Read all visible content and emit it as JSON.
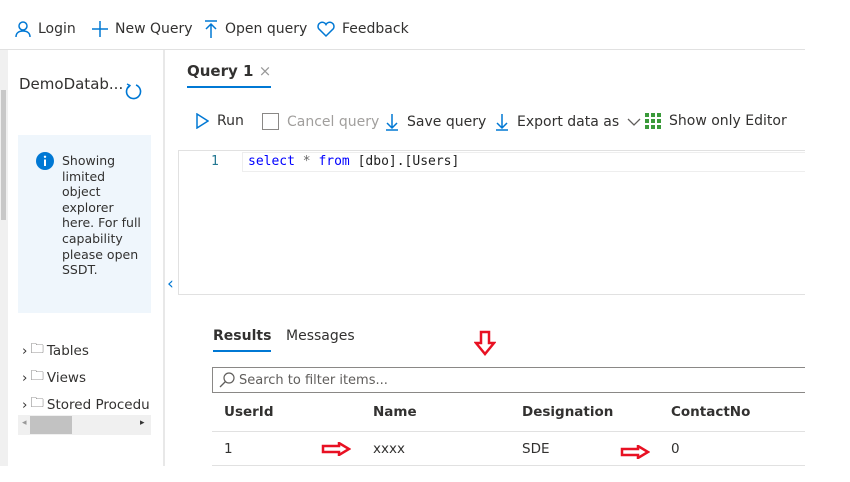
{
  "toolbar": {
    "login": "Login",
    "new_query": "New Query",
    "open_query": "Open query",
    "feedback": "Feedback"
  },
  "sidebar": {
    "db_name": "DemoDatab...",
    "info": "Showing limited object explorer here. For full capability please open SSDT.",
    "tree": [
      "Tables",
      "Views",
      "Stored Procedu"
    ]
  },
  "query_tab": {
    "label": "Query 1"
  },
  "query_toolbar": {
    "run": "Run",
    "cancel": "Cancel query",
    "save": "Save query",
    "export": "Export data as",
    "show_editor": "Show only Editor"
  },
  "editor": {
    "line_number": "1",
    "code_kw1": "select",
    "code_rest": " * ",
    "code_kw2": "from",
    "code_obj": " [dbo].[Users]"
  },
  "results": {
    "tabs": [
      "Results",
      "Messages"
    ],
    "search_placeholder": "Search to filter items...",
    "columns": [
      "UserId",
      "Name",
      "Designation",
      "ContactNo"
    ],
    "rows": [
      [
        "1",
        "xxxx",
        "SDE",
        "0"
      ]
    ]
  },
  "colors": {
    "accent": "#0078d4",
    "annotation": "#e81123"
  }
}
